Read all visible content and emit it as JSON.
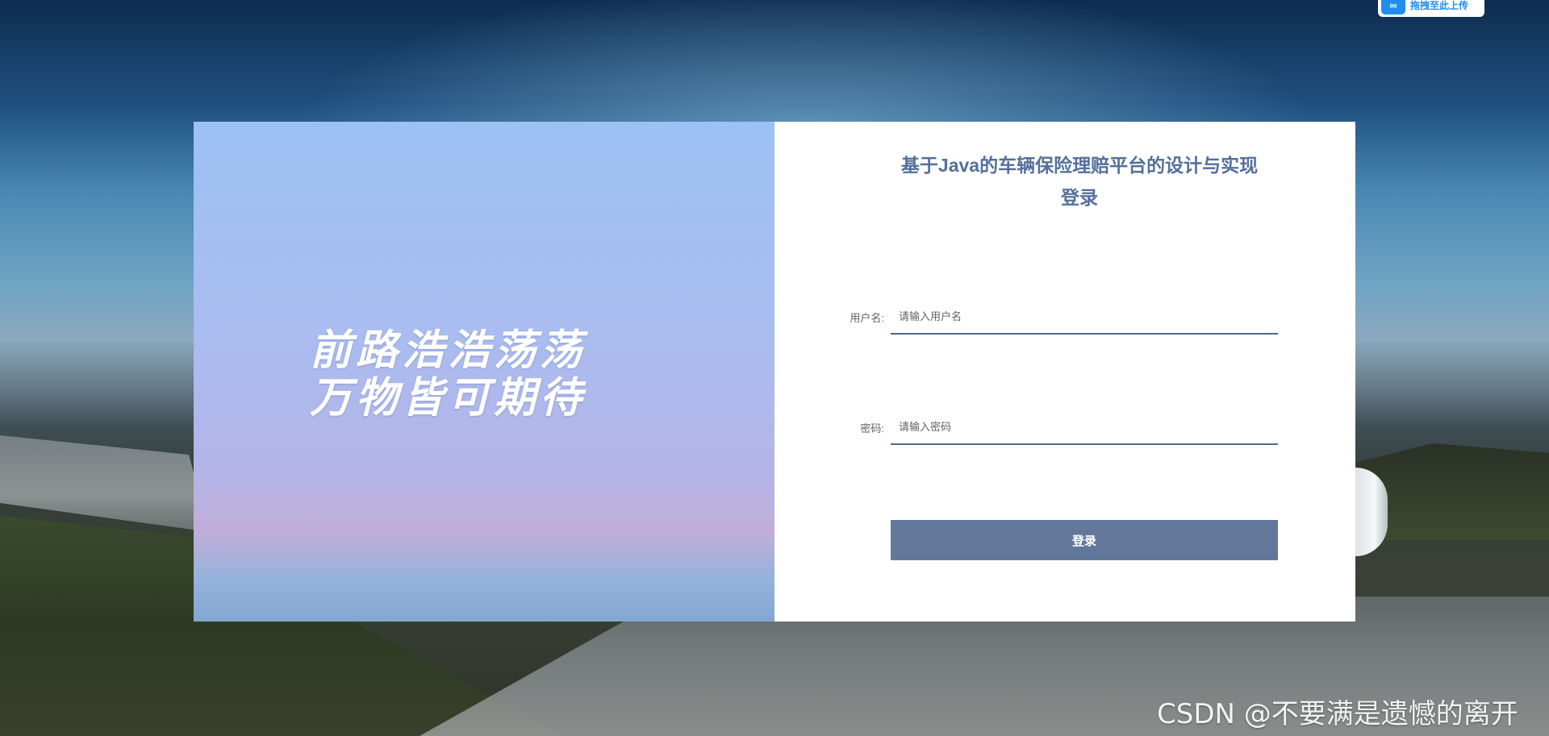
{
  "background": {
    "upload_badge": {
      "icon": "cloud-link-icon",
      "label": "拖拽至此上传"
    }
  },
  "left_panel": {
    "slogan_line1": "前路浩浩荡荡",
    "slogan_line2": "万物皆可期待"
  },
  "login_form": {
    "title_line1": "基于Java的车辆保险理赔平台的设计与实现",
    "title_line2": "登录",
    "username": {
      "label": "用户名:",
      "placeholder": "请输入用户名",
      "value": ""
    },
    "password": {
      "label": "密码:",
      "placeholder": "请输入密码",
      "value": ""
    },
    "submit_label": "登录"
  },
  "watermark": "CSDN @不要满是遗憾的离开",
  "colors": {
    "title": "#54709b",
    "button": "#62789b",
    "input_underline": "#4e6a8c"
  }
}
